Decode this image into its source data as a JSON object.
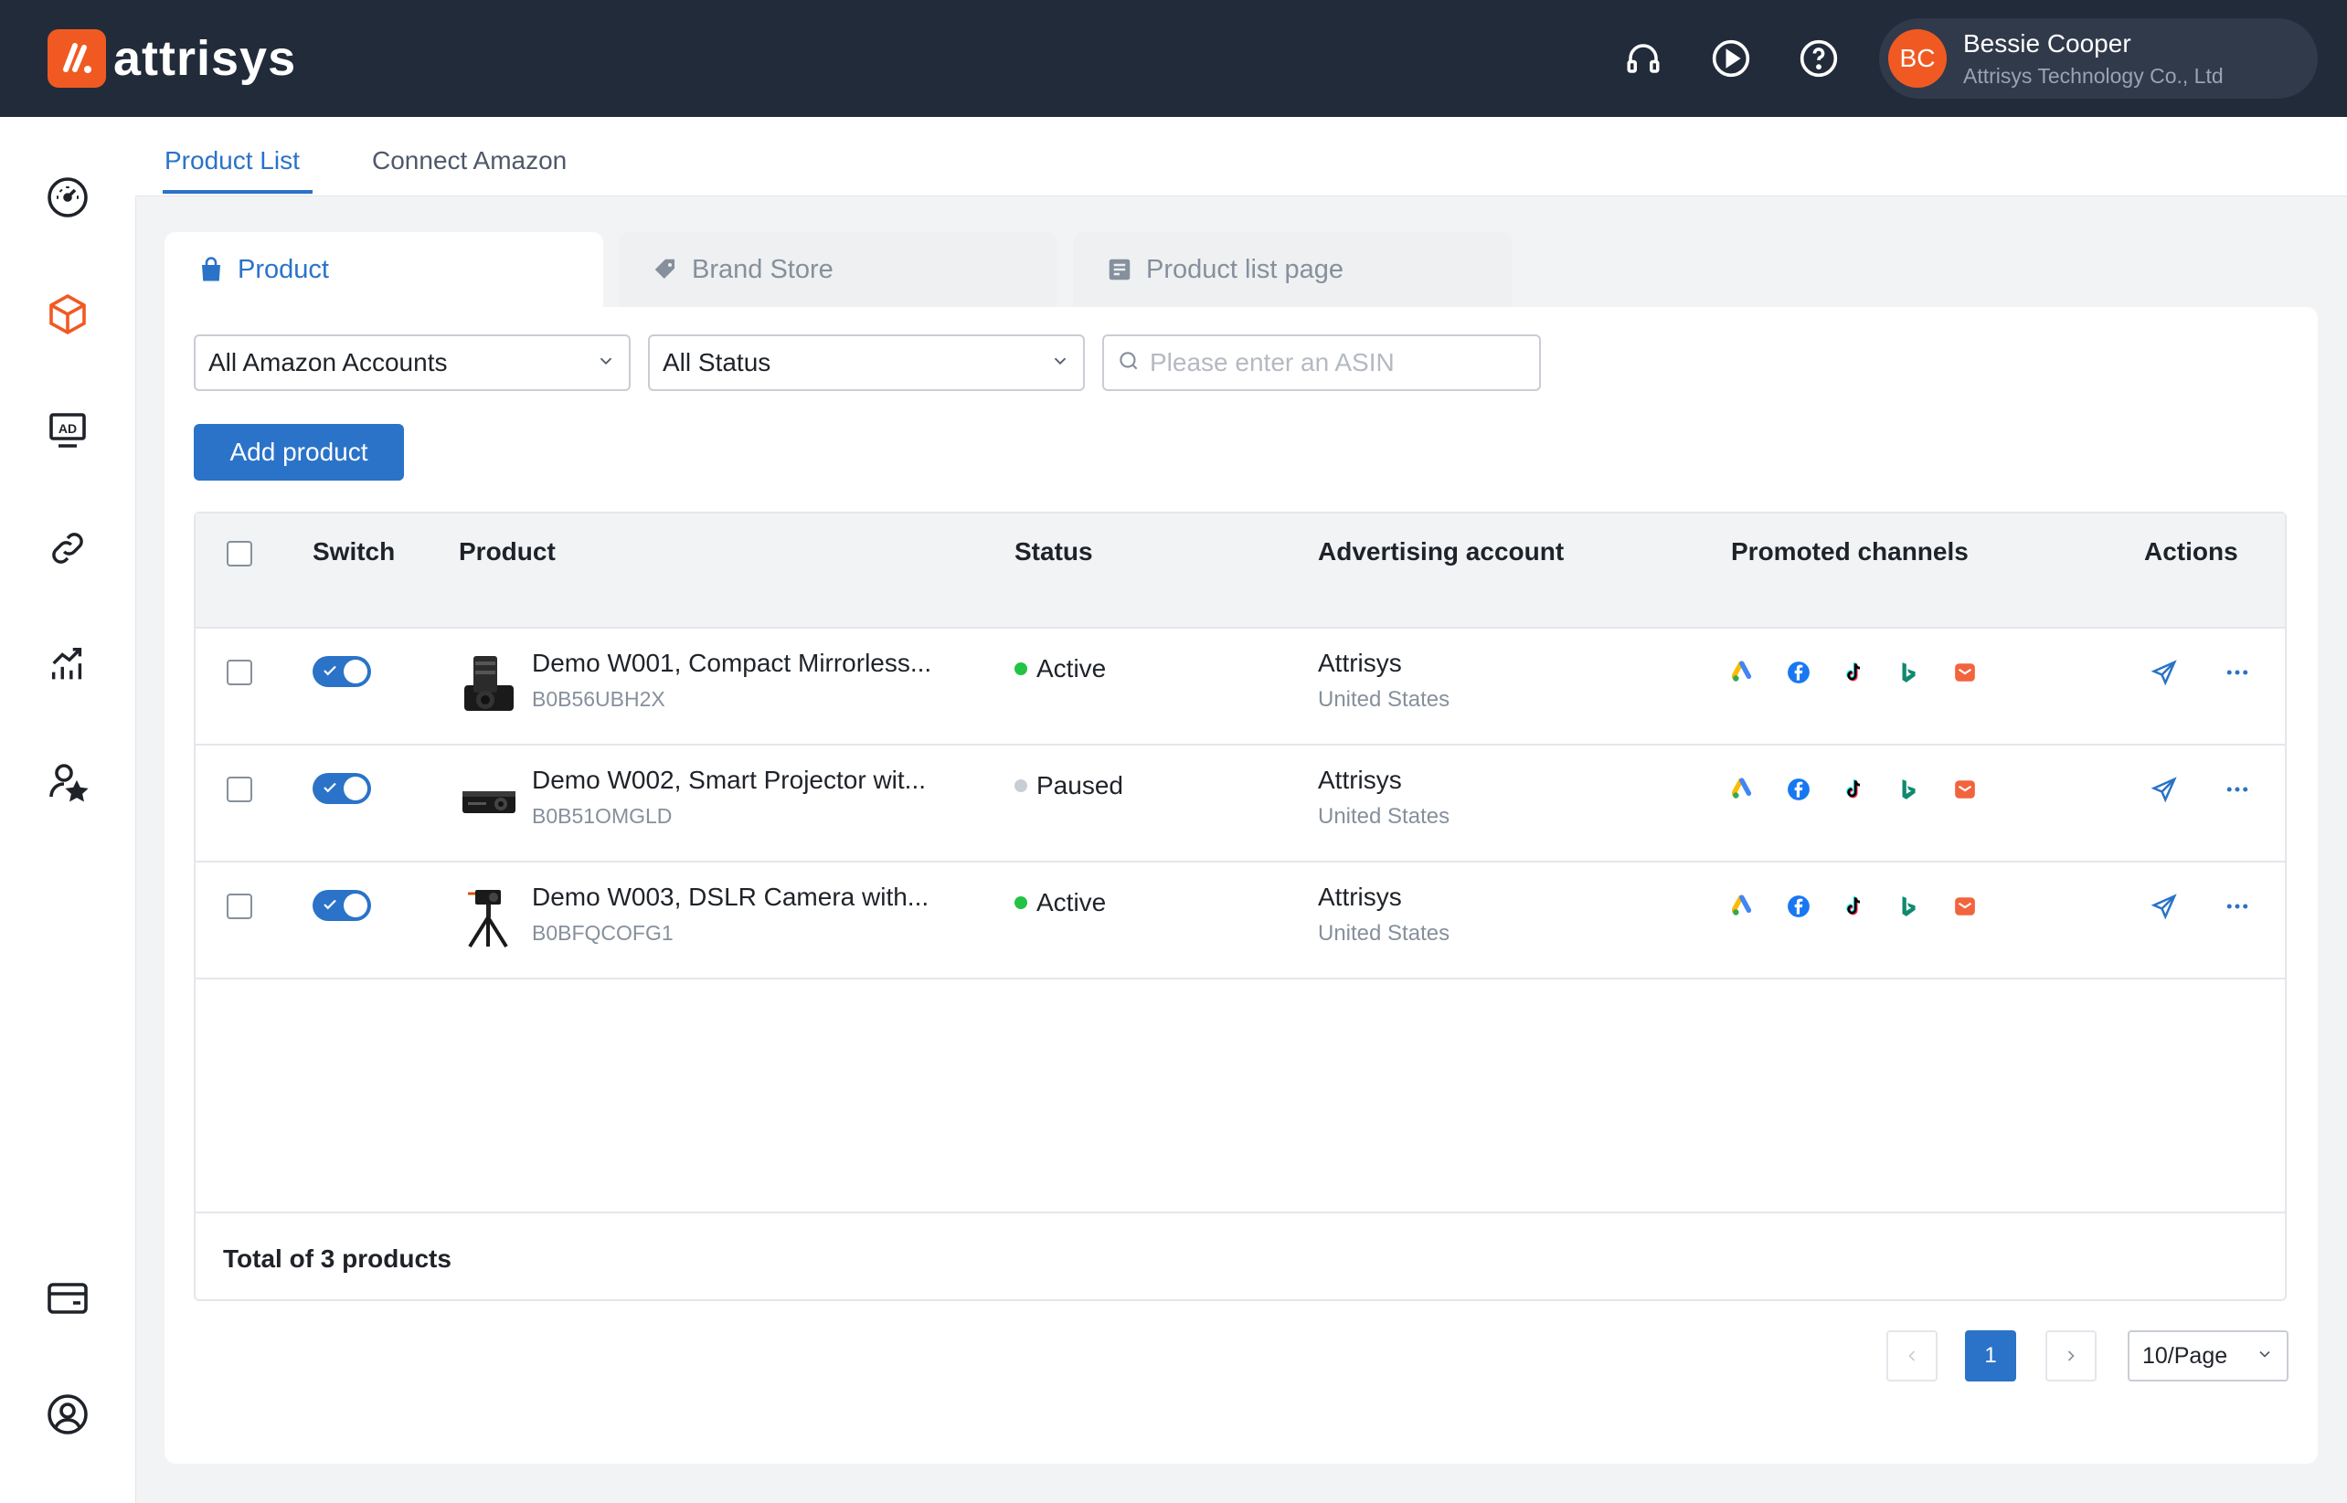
{
  "app": {
    "logo_text": "attrisys",
    "brand_color": "#f05a22",
    "accent_color": "#2a73c8"
  },
  "header": {
    "icons": [
      "headset-icon",
      "play-icon",
      "help-icon"
    ],
    "user": {
      "initials": "BC",
      "name": "Bessie Cooper",
      "org": "Attrisys Technology Co., Ltd"
    }
  },
  "sidebar": {
    "items": [
      "dashboard-icon",
      "product-box-icon",
      "ad-icon",
      "link-icon",
      "analytics-icon",
      "user-star-icon"
    ],
    "bottom": [
      "wallet-icon",
      "account-icon"
    ],
    "active": "product-box-icon"
  },
  "top_tabs": [
    "Product List",
    "Connect Amazon"
  ],
  "category_tabs": [
    "Product",
    "Brand Store",
    "Product list page"
  ],
  "filters": {
    "account": "All Amazon Accounts",
    "status": "All Status",
    "search_placeholder": "Please enter an ASIN"
  },
  "add_button": "Add product",
  "table": {
    "headers": [
      "Switch",
      "Product",
      "Status",
      "Advertising account",
      "Promoted channels",
      "Actions"
    ],
    "rows": [
      {
        "name": "Demo W001, Compact Mirrorless...",
        "asin": "B0B56UBH2X",
        "status": "Active",
        "status_color": "#23c343",
        "account": "Attrisys",
        "country": "United States",
        "image": "camera"
      },
      {
        "name": "Demo W002, Smart Projector wit...",
        "asin": "B0B51OMGLD",
        "status": "Paused",
        "status_color": "#c9cdd4",
        "account": "Attrisys",
        "country": "United States",
        "image": "projector"
      },
      {
        "name": "Demo W003, DSLR Camera with...",
        "asin": "B0BFQCOFG1",
        "status": "Active",
        "status_color": "#23c343",
        "account": "Attrisys",
        "country": "United States",
        "image": "tripod-camera"
      }
    ],
    "channels": [
      "google-ads-icon",
      "facebook-icon",
      "tiktok-icon",
      "bing-icon",
      "email-icon"
    ],
    "total": "Total of 3 products"
  },
  "pagination": {
    "current": "1",
    "page_size": "10/Page"
  }
}
